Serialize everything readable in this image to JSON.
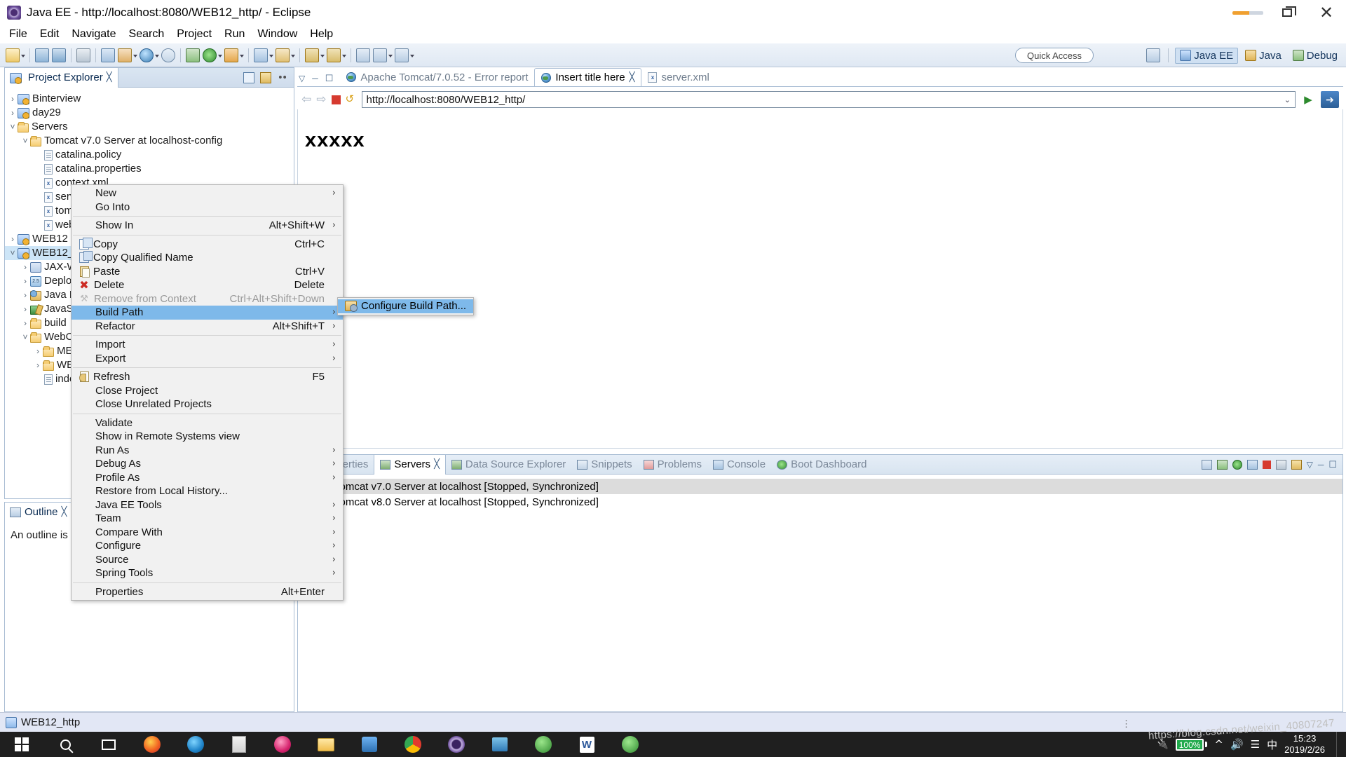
{
  "window": {
    "title": "Java EE - http://localhost:8080/WEB12_http/ - Eclipse",
    "icon": "eclipse-icon",
    "minimize_label": "—",
    "restore_label": "❐",
    "close_label": "✕"
  },
  "menubar": {
    "items": [
      "File",
      "Edit",
      "Navigate",
      "Search",
      "Project",
      "Run",
      "Window",
      "Help"
    ]
  },
  "toolbar": {
    "quick_access_placeholder": "Quick Access",
    "perspectives": [
      {
        "label": "Java EE",
        "active": true
      },
      {
        "label": "Java",
        "active": false
      },
      {
        "label": "Debug",
        "active": false
      }
    ]
  },
  "project_explorer": {
    "tab_label": "Project Explorer",
    "close_glyph": "╳",
    "tools": [
      "collapse-all-icon",
      "link-with-editor-icon",
      "view-menu-icon"
    ],
    "tree": [
      {
        "label": "Binterview",
        "indent": 0,
        "twist": "›",
        "icon": "project-icon"
      },
      {
        "label": "day29",
        "indent": 0,
        "twist": "›",
        "icon": "project-icon"
      },
      {
        "label": "Servers",
        "indent": 0,
        "twist": "˅",
        "icon": "folder-icon"
      },
      {
        "label": "Tomcat v7.0 Server at localhost-config",
        "indent": 1,
        "twist": "˅",
        "icon": "folder-icon"
      },
      {
        "label": "catalina.policy",
        "indent": 2,
        "twist": "",
        "icon": "file-icon"
      },
      {
        "label": "catalina.properties",
        "indent": 2,
        "twist": "",
        "icon": "file-icon"
      },
      {
        "label": "context.xml",
        "indent": 2,
        "twist": "",
        "icon": "xml-file-icon"
      },
      {
        "label": "server.xml",
        "indent": 2,
        "twist": "",
        "icon": "xml-file-icon"
      },
      {
        "label": "tomcat-users.xml",
        "indent": 2,
        "twist": "",
        "icon": "xml-file-icon"
      },
      {
        "label": "web.xml",
        "indent": 2,
        "twist": "",
        "icon": "xml-file-icon"
      },
      {
        "label": "WEB12",
        "indent": 0,
        "twist": "›",
        "icon": "project-icon"
      },
      {
        "label": "WEB12_http",
        "indent": 0,
        "twist": "˅",
        "icon": "project-icon",
        "selected": true
      },
      {
        "label": "JAX-WS Web Services",
        "indent": 1,
        "twist": "›",
        "icon": "jaxws-icon"
      },
      {
        "label": "Deployment Descriptor: WEB12_http",
        "indent": 1,
        "twist": "›",
        "icon": "deployment-descriptor-icon"
      },
      {
        "label": "Java Resources",
        "indent": 1,
        "twist": "›",
        "icon": "java-resources-icon"
      },
      {
        "label": "JavaScript Resources",
        "indent": 1,
        "twist": "›",
        "icon": "javascript-resources-icon"
      },
      {
        "label": "build",
        "indent": 1,
        "twist": "›",
        "icon": "folder-icon"
      },
      {
        "label": "WebContent",
        "indent": 1,
        "twist": "˅",
        "icon": "folder-icon"
      },
      {
        "label": "META-INF",
        "indent": 2,
        "twist": "›",
        "icon": "folder-icon"
      },
      {
        "label": "WEB-INF",
        "indent": 2,
        "twist": "›",
        "icon": "folder-icon"
      },
      {
        "label": "index.jsp",
        "indent": 2,
        "twist": "",
        "icon": "file-icon"
      }
    ]
  },
  "outline": {
    "tab_label": "Outline",
    "close_glyph": "╳",
    "message": "An outline is not available."
  },
  "editor": {
    "tabs": [
      {
        "label": "Apache Tomcat/7.0.52 - Error report",
        "icon": "globe-icon",
        "active": false,
        "closeable": false
      },
      {
        "label": "Insert title here",
        "icon": "globe-icon",
        "active": true,
        "closeable": true
      },
      {
        "label": "server.xml",
        "icon": "xml-file-icon",
        "active": false,
        "closeable": false
      }
    ],
    "close_glyph": "╳",
    "browser": {
      "back_glyph": "⇦",
      "forward_glyph": "⇨",
      "stop_label": "stop-icon",
      "refresh_label": "refresh-icon",
      "url": "http://localhost:8080/WEB12_http/",
      "dropdown_glyph": "⌄",
      "go_glyph": "▶",
      "open_external_glyph": "➔",
      "page_content": "xxxxx"
    }
  },
  "bottom_panel": {
    "tabs": [
      {
        "label": "Properties",
        "icon": "properties-icon",
        "active": false
      },
      {
        "label": "Servers",
        "icon": "servers-icon",
        "active": true
      },
      {
        "label": "Data Source Explorer",
        "icon": "data-source-icon",
        "active": false
      },
      {
        "label": "Snippets",
        "icon": "snippets-icon",
        "active": false
      },
      {
        "label": "Problems",
        "icon": "problems-icon",
        "active": false
      },
      {
        "label": "Console",
        "icon": "console-icon",
        "active": false
      },
      {
        "label": "Boot Dashboard",
        "icon": "boot-dashboard-icon",
        "active": false
      }
    ],
    "close_glyph": "╳",
    "servers": [
      {
        "label": "Tomcat v7.0 Server at localhost  [Stopped, Synchronized]",
        "selected": true
      },
      {
        "label": "Tomcat v8.0 Server at localhost  [Stopped, Synchronized]",
        "selected": false
      }
    ]
  },
  "context_menu": {
    "items": [
      {
        "label": "New",
        "accel": "",
        "submenu": true,
        "icon": "",
        "disabled": false
      },
      {
        "label": "Go Into",
        "accel": "",
        "submenu": false,
        "icon": "",
        "disabled": false
      },
      {
        "separator_after": true
      },
      {
        "label": "Show In",
        "accel": "Alt+Shift+W",
        "submenu": true,
        "icon": "",
        "disabled": false
      },
      {
        "separator_after": true
      },
      {
        "label": "Copy",
        "accel": "Ctrl+C",
        "submenu": false,
        "icon": "copy-icon",
        "disabled": false
      },
      {
        "label": "Copy Qualified Name",
        "accel": "",
        "submenu": false,
        "icon": "copy-qualified-name-icon",
        "disabled": false
      },
      {
        "label": "Paste",
        "accel": "Ctrl+V",
        "submenu": false,
        "icon": "paste-icon",
        "disabled": false
      },
      {
        "label": "Delete",
        "accel": "Delete",
        "submenu": false,
        "icon": "delete-icon",
        "disabled": false
      },
      {
        "label": "Remove from Context",
        "accel": "Ctrl+Alt+Shift+Down",
        "submenu": false,
        "icon": "remove-from-context-icon",
        "disabled": true
      },
      {
        "label": "Build Path",
        "accel": "",
        "submenu": true,
        "icon": "",
        "disabled": false,
        "highlighted": true
      },
      {
        "label": "Refactor",
        "accel": "Alt+Shift+T",
        "submenu": true,
        "icon": "",
        "disabled": false
      },
      {
        "separator_after": true
      },
      {
        "label": "Import",
        "accel": "",
        "submenu": true,
        "icon": "",
        "disabled": false
      },
      {
        "label": "Export",
        "accel": "",
        "submenu": true,
        "icon": "",
        "disabled": false
      },
      {
        "separator_after": true
      },
      {
        "label": "Refresh",
        "accel": "F5",
        "submenu": false,
        "icon": "refresh-icon",
        "disabled": false
      },
      {
        "label": "Close Project",
        "accel": "",
        "submenu": false,
        "icon": "",
        "disabled": false
      },
      {
        "label": "Close Unrelated Projects",
        "accel": "",
        "submenu": false,
        "icon": "",
        "disabled": false
      },
      {
        "separator_after": true
      },
      {
        "label": "Validate",
        "accel": "",
        "submenu": false,
        "icon": "",
        "disabled": false
      },
      {
        "label": "Show in Remote Systems view",
        "accel": "",
        "submenu": false,
        "icon": "",
        "disabled": false
      },
      {
        "label": "Run As",
        "accel": "",
        "submenu": true,
        "icon": "",
        "disabled": false
      },
      {
        "label": "Debug As",
        "accel": "",
        "submenu": true,
        "icon": "",
        "disabled": false
      },
      {
        "label": "Profile As",
        "accel": "",
        "submenu": true,
        "icon": "",
        "disabled": false
      },
      {
        "label": "Restore from Local History...",
        "accel": "",
        "submenu": false,
        "icon": "",
        "disabled": false
      },
      {
        "label": "Java EE Tools",
        "accel": "",
        "submenu": true,
        "icon": "",
        "disabled": false
      },
      {
        "label": "Team",
        "accel": "",
        "submenu": true,
        "icon": "",
        "disabled": false
      },
      {
        "label": "Compare With",
        "accel": "",
        "submenu": true,
        "icon": "",
        "disabled": false
      },
      {
        "label": "Configure",
        "accel": "",
        "submenu": true,
        "icon": "",
        "disabled": false
      },
      {
        "label": "Source",
        "accel": "",
        "submenu": true,
        "icon": "",
        "disabled": false
      },
      {
        "label": "Spring Tools",
        "accel": "",
        "submenu": true,
        "icon": "",
        "disabled": false
      },
      {
        "separator_after": true
      },
      {
        "label": "Properties",
        "accel": "Alt+Enter",
        "submenu": false,
        "icon": "",
        "disabled": false
      }
    ],
    "submenu": {
      "items": [
        {
          "label": "Configure Build Path...",
          "icon": "build-path-icon",
          "highlighted": true
        }
      ]
    }
  },
  "statusbar": {
    "text": "WEB12_http",
    "icon": "project-icon",
    "grip": "⋮"
  },
  "taskbar": {
    "items": [
      "windows-start-icon",
      "search-icon",
      "task-view-icon",
      "firefox-icon",
      "edge-icon",
      "calculator-icon",
      "compass-icon",
      "file-explorer-icon",
      "translate-icon",
      "chrome-icon",
      "eclipse-icon",
      "outlook-icon",
      "git-icon",
      "word-icon",
      "spring-icon"
    ],
    "tray": {
      "battery_percent": "100%",
      "network_icon": "network-icon",
      "volume_icon": "volume-icon",
      "chevron_icon": "show-hidden-icons-icon",
      "time": "15:23",
      "date": "2019/2/26"
    }
  },
  "watermark": "https://blog.csdn.net/weixin_40807247"
}
